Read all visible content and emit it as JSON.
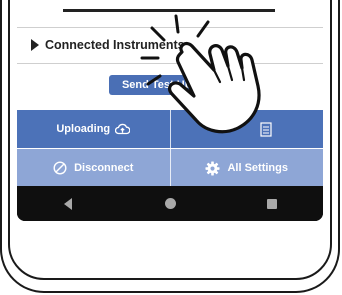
{
  "screen": {
    "connected_instruments": "Connected Instruments",
    "send_button": "Send Test Upload",
    "uploading_label": "Uploading",
    "disconnect_label": "Disconnect",
    "all_settings_label": "All Settings"
  },
  "icons": {
    "expand": "caret-right-icon",
    "uploading": "cloud-upload-icon",
    "second_cell": "document-icon",
    "disconnect": "no-entry-icon",
    "settings": "gear-icon",
    "nav_back": "back-triangle-icon",
    "nav_home": "home-circle-icon",
    "nav_recent": "recent-square-icon",
    "overlay": "tap-hand-icon"
  },
  "colors": {
    "primary_row": "#4c72b8",
    "secondary_row": "#8ea6d6",
    "button": "#4a6fb5",
    "navbar": "#0f0f0f"
  }
}
